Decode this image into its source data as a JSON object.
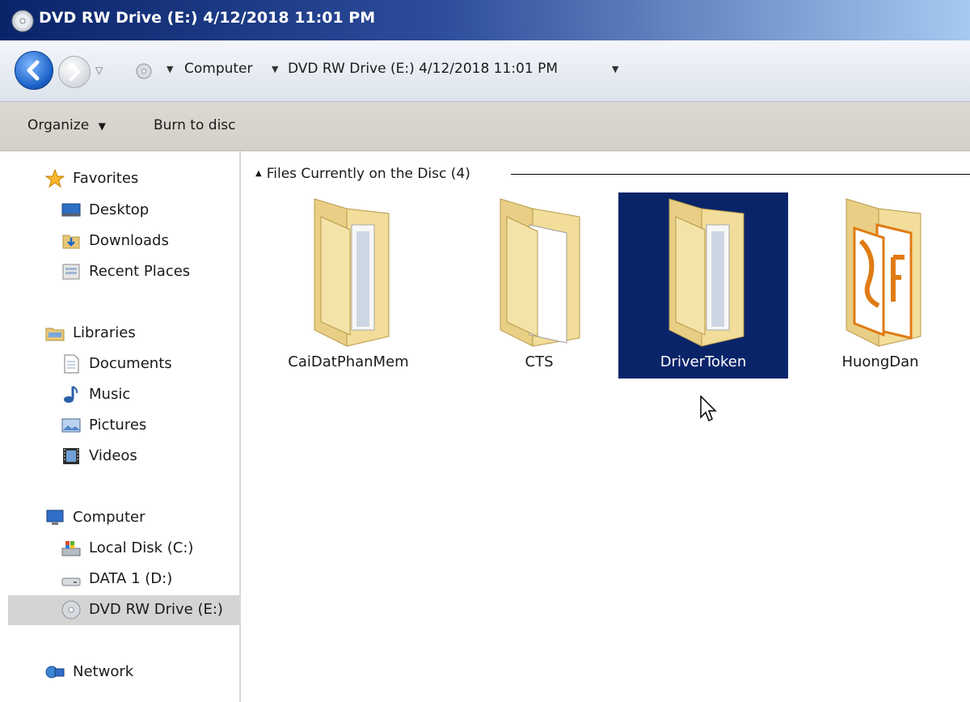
{
  "window": {
    "title": "DVD RW Drive (E:) 4/12/2018 11:01 PM"
  },
  "address_bar": {
    "crumbs": [
      "Computer",
      "DVD RW Drive (E:) 4/12/2018 11:01 PM"
    ]
  },
  "command_bar": {
    "organize": "Organize",
    "burn": "Burn to disc"
  },
  "navigation": {
    "favorites": {
      "label": "Favorites",
      "items": [
        "Desktop",
        "Downloads",
        "Recent Places"
      ]
    },
    "libraries": {
      "label": "Libraries",
      "items": [
        "Documents",
        "Music",
        "Pictures",
        "Videos"
      ]
    },
    "computer": {
      "label": "Computer",
      "items": [
        "Local Disk (C:)",
        "DATA 1 (D:)",
        "DVD RW Drive (E:)"
      ]
    },
    "network": {
      "label": "Network"
    },
    "selected_item": "DVD RW Drive (E:)"
  },
  "content": {
    "group_header": "Files Currently on the Disc (4)",
    "files": [
      {
        "name": "CaiDatPhanMem",
        "icon": "folder-documents-icon"
      },
      {
        "name": "CTS",
        "icon": "folder-blank-icon"
      },
      {
        "name": "DriverToken",
        "icon": "folder-documents-icon",
        "selected": true
      },
      {
        "name": "HuongDan",
        "icon": "folder-pdf-icon"
      }
    ]
  },
  "colors": {
    "title_gradient_start": "#0a246a",
    "selection": "#0a246a",
    "nav_selection": "#d4d4d4"
  }
}
